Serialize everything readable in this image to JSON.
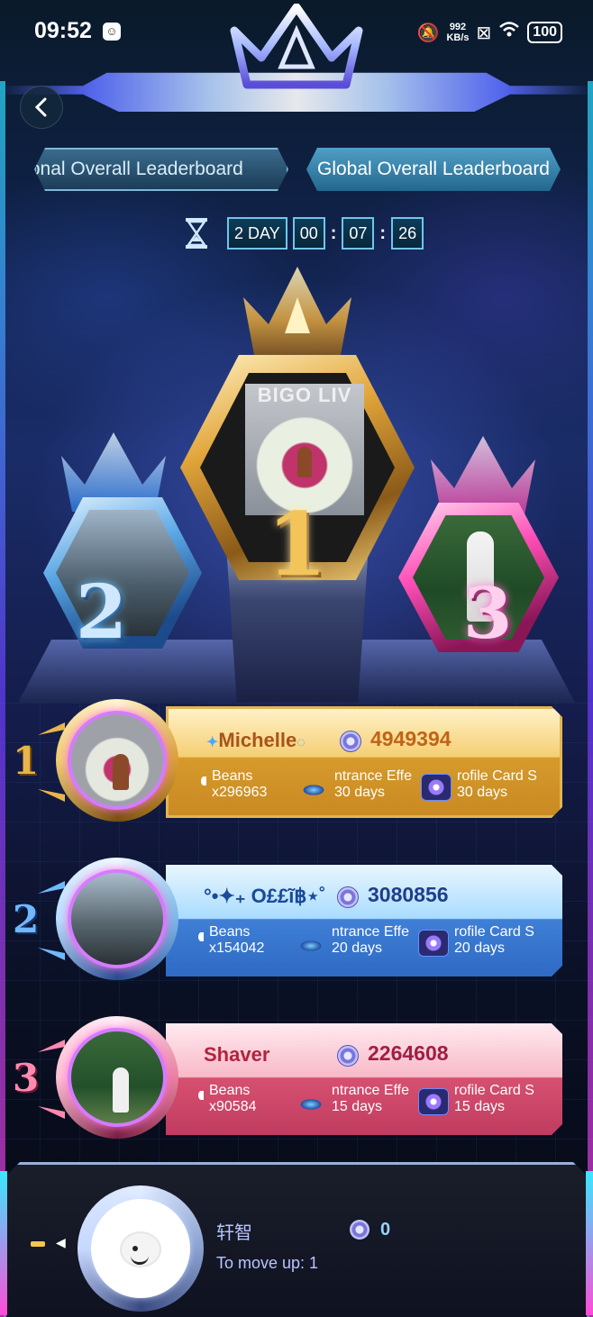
{
  "status_bar": {
    "time": "09:52",
    "net_speed_value": "992",
    "net_speed_unit": "KB/s",
    "battery": "100",
    "icons": [
      "app-icon",
      "mute-icon",
      "sim-icon",
      "wifi-icon",
      "battery-icon"
    ]
  },
  "tabs": [
    {
      "label": "Regional Overall Leaderboard",
      "visible_text": "ional Overall Leaderboard",
      "selected": false
    },
    {
      "label": "Global Overall Leaderboard",
      "visible_text": "Global Overall Leaderboard",
      "selected": true
    }
  ],
  "countdown": {
    "days": "2 DAY",
    "hours": "00",
    "minutes": "07",
    "seconds": "26",
    "separator": ":"
  },
  "podium": {
    "first_number": "1",
    "second_number": "2",
    "third_number": "3",
    "watermark": "BIGO LIV"
  },
  "leaderboard": [
    {
      "rank": "1",
      "name": "Michelle",
      "score": "4949394",
      "rewards": {
        "beans_label": "Beans",
        "beans_value": "x296963",
        "entrance_label": "ntrance Effe",
        "entrance_value": "30 days",
        "profile_label": "rofile Card S",
        "profile_value": "30 days"
      }
    },
    {
      "rank": "2",
      "name": "°•✦₊ O££ĩ฿⋆˚",
      "score": "3080856",
      "rewards": {
        "beans_label": "Beans",
        "beans_value": "x154042",
        "entrance_label": "ntrance Effe",
        "entrance_value": "20 days",
        "profile_label": "rofile Card S",
        "profile_value": "20 days"
      }
    },
    {
      "rank": "3",
      "name": "Shaver",
      "score": "2264608",
      "rewards": {
        "beans_label": "Beans",
        "beans_value": "x90584",
        "entrance_label": "ntrance Effe",
        "entrance_value": "15 days",
        "profile_label": "rofile Card S",
        "profile_value": "15 days"
      }
    }
  ],
  "my_rank": {
    "name": "轩智",
    "move_up_text": "To move up: 1",
    "score": "0"
  },
  "colors": {
    "gold": "#e2b552",
    "silver_blue": "#6fb8ff",
    "bronze_pink": "#d65070",
    "tab_selected": "#4f9fc6",
    "accent_cyan": "#2ae0ff"
  }
}
